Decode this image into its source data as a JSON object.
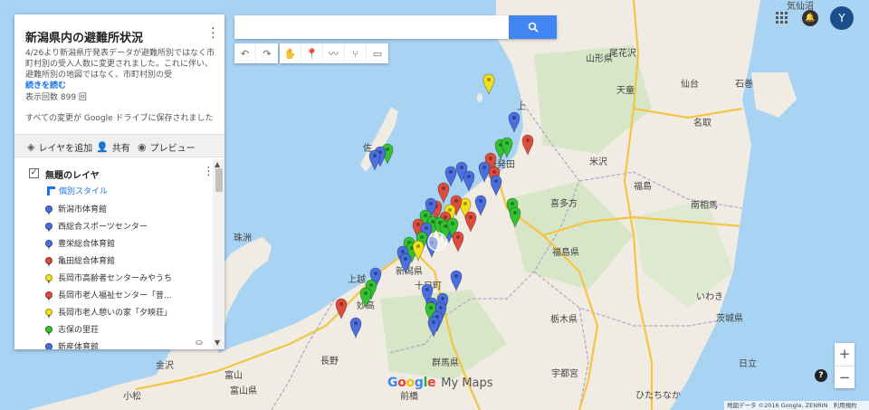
{
  "colors": {
    "blue": "#4a6fe0",
    "red": "#de4c3e",
    "yellow": "#f2e01a",
    "green": "#33c233",
    "accent": "#4285f4",
    "avatar": "#1a4f8b"
  },
  "panel": {
    "title": "新潟県内の避難所状況",
    "description": "4/26より新潟県庁発表データが避難所別ではなく市町村別の受入人数に変更されました。これに伴い、避難所別の地図ではなく、市町村別の受",
    "more_link": "続きを読む",
    "views": "表示回数 899 回",
    "saved": "すべての変更が Google ドライブに保存されました",
    "actions": {
      "add_layer": "レイヤを追加",
      "share": "共有",
      "preview": "プレビュー"
    },
    "layer": {
      "name": "無題のレイヤ",
      "style_link": "個別スタイル",
      "places": [
        {
          "name": "新潟市体育館",
          "color": "blue"
        },
        {
          "name": "西総合スポーツセンター",
          "color": "blue"
        },
        {
          "name": "豊栄総合体育館",
          "color": "blue"
        },
        {
          "name": "亀田総合体育館",
          "color": "red"
        },
        {
          "name": "長岡市高齢者センターみやうち",
          "color": "yellow"
        },
        {
          "name": "長岡市老人福祉センター「昔...",
          "color": "red"
        },
        {
          "name": "長岡市老人憩いの家「夕映荘」",
          "color": "yellow"
        },
        {
          "name": "志保の里荘",
          "color": "green"
        },
        {
          "name": "新産体育館",
          "color": "blue"
        }
      ]
    }
  },
  "search": {
    "placeholder": ""
  },
  "toolbar": {
    "undo_icon": "undo-icon",
    "redo_icon": "redo-icon"
  },
  "user": {
    "avatar_letter": "Y"
  },
  "map": {
    "labels": [
      {
        "text": "気仙沼"
      },
      {
        "text": "山形県"
      },
      {
        "text": "尾花沢"
      },
      {
        "text": "上"
      },
      {
        "text": "天童"
      },
      {
        "text": "仙台"
      },
      {
        "text": "石巻"
      },
      {
        "text": "名取"
      },
      {
        "text": "新発田"
      },
      {
        "text": "米沢"
      },
      {
        "text": "喜多方"
      },
      {
        "text": "福島"
      },
      {
        "text": "南相馬"
      },
      {
        "text": "珠洲"
      },
      {
        "text": "佐"
      },
      {
        "text": "新潟県"
      },
      {
        "text": "福島県"
      },
      {
        "text": "上越"
      },
      {
        "text": "妙高"
      },
      {
        "text": "長野"
      },
      {
        "text": "群馬県"
      },
      {
        "text": "栃木県"
      },
      {
        "text": "茨城県"
      },
      {
        "text": "宇都宮"
      },
      {
        "text": "いわき"
      },
      {
        "text": "富山"
      },
      {
        "text": "富山県"
      },
      {
        "text": "金沢"
      },
      {
        "text": "小松"
      },
      {
        "text": "ひたちなか"
      },
      {
        "text": "前橋"
      },
      {
        "text": "日立"
      },
      {
        "text": "十日町"
      }
    ]
  },
  "brand": {
    "google": "Google",
    "product": "My Maps"
  },
  "attribution": {
    "text": "地図データ ©2016 Google, ZENRIN",
    "terms": "利用規約"
  }
}
